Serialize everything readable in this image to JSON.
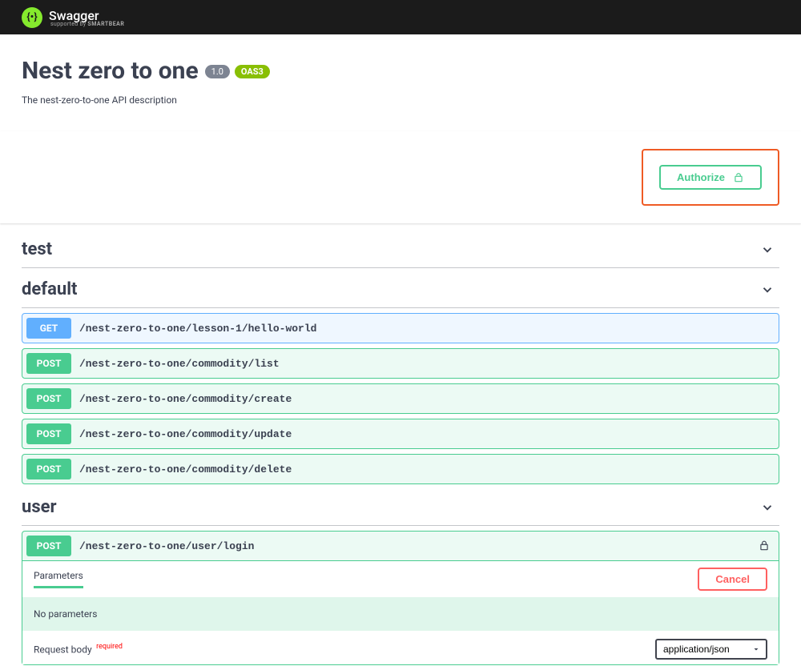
{
  "header": {
    "logo_text": "Swagger",
    "logo_glyph": "{•}",
    "supported_prefix": "supported by ",
    "supported_brand": "SMARTBEAR"
  },
  "info": {
    "title": "Nest zero to one",
    "version": "1.0",
    "oas": "OAS3",
    "description": "The nest-zero-to-one API description"
  },
  "auth": {
    "authorize_label": "Authorize"
  },
  "tags": [
    {
      "name": "test",
      "operations": []
    },
    {
      "name": "default",
      "operations": [
        {
          "method": "GET",
          "path": "/nest-zero-to-one/lesson-1/hello-world"
        },
        {
          "method": "POST",
          "path": "/nest-zero-to-one/commodity/list"
        },
        {
          "method": "POST",
          "path": "/nest-zero-to-one/commodity/create"
        },
        {
          "method": "POST",
          "path": "/nest-zero-to-one/commodity/update"
        },
        {
          "method": "POST",
          "path": "/nest-zero-to-one/commodity/delete"
        }
      ]
    },
    {
      "name": "user",
      "operations": [
        {
          "method": "POST",
          "path": "/nest-zero-to-one/user/login",
          "expanded": true,
          "secured": true,
          "parameters_tab": "Parameters",
          "cancel_label": "Cancel",
          "no_parameters_text": "No parameters",
          "request_body_label": "Request body",
          "required_label": "required",
          "content_type": "application/json"
        }
      ]
    }
  ]
}
